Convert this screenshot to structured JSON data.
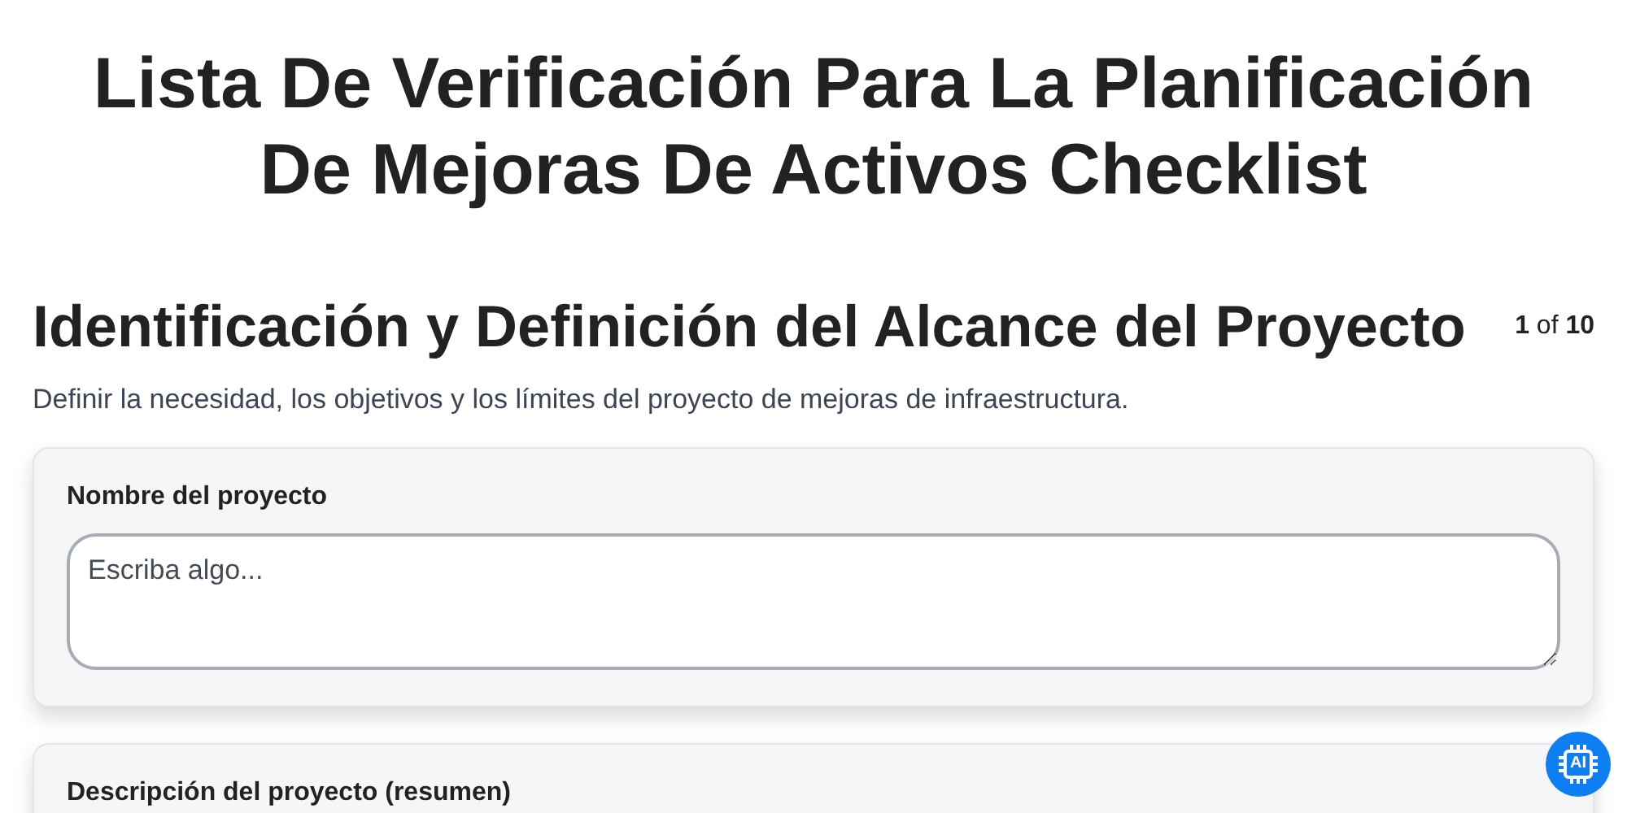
{
  "title": "Lista De Verificación Para La Planificación De Mejoras De Activos Checklist",
  "section": {
    "heading": "Identificación y Definición del Alcance del Proyecto",
    "counter": "**1** of **10**",
    "description": "Definir la necesidad, los objetivos y los límites del proyecto de mejoras de infraestructura."
  },
  "fields": [
    {
      "label": "Nombre del proyecto",
      "placeholder": "Escriba algo..."
    },
    {
      "label": "Descripción del proyecto (resumen)"
    }
  ],
  "ai_button": {
    "label": "AI"
  }
}
